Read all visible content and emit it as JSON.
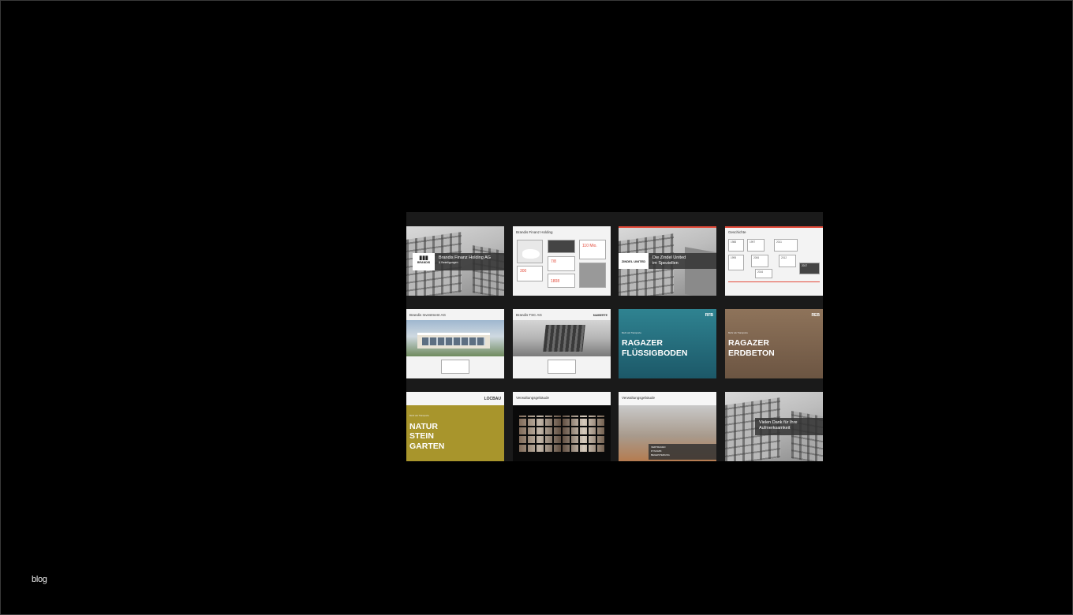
{
  "footer": {
    "blog_label": "blog"
  },
  "slides": {
    "s1": {
      "title": "Brandis Finanz Holding AG",
      "subtitle": "& Beteiligungen",
      "logo": "BRANDIS"
    },
    "s2": {
      "header": "Brandis Finanz Holding",
      "stat_value_1": "110 Mio.",
      "stat_value_2": "7/8",
      "stat_value_3": "300",
      "stat_value_4": "1808"
    },
    "s3": {
      "logo": "ZINDEL UNITED",
      "title_line1": "Die Zindel United",
      "title_line2": "im Speziellen"
    },
    "s4": {
      "header": "Geschichte",
      "y1": "1988",
      "y2": "1997",
      "y3": "2011",
      "y4": "1995",
      "y5": "2006",
      "y6": "2012",
      "y7": "2016",
      "y8": "2017"
    },
    "s5": {
      "header": "Brandis Investment AG"
    },
    "s6": {
      "header": "Brandis TSC AG",
      "logo": "MAIBERTE"
    },
    "s7": {
      "logo": "RFB",
      "kicker": "Mehr als Transporte",
      "line1": "RAGAZER",
      "line2": "FLÜSSIGBODEN"
    },
    "s8": {
      "logo": "REB",
      "kicker": "Mehr als Transporte",
      "line1": "RAGAZER",
      "line2": "ERDBETON"
    },
    "s9": {
      "logo": "LOCBAU",
      "kicker": "Mehr als Transporte",
      "line1": "NATUR",
      "line2": "STEIN",
      "line3": "GARTEN"
    },
    "s10": {
      "header": "Verwaltungsgebäude"
    },
    "s11": {
      "header": "Verwaltungsgebäude",
      "bullet1": "VERTRAUEN",
      "bullet2": "DYNAMIK",
      "bullet3": "BEGEISTERUNG"
    },
    "s12": {
      "line1": "Vielen Dank für Ihre",
      "line2": "Aufmerksamkeit"
    }
  },
  "colors": {
    "accent_red": "#e34b3b",
    "teal": "#1f6f7f",
    "brown": "#8a6e55",
    "olive": "#a8952c"
  }
}
